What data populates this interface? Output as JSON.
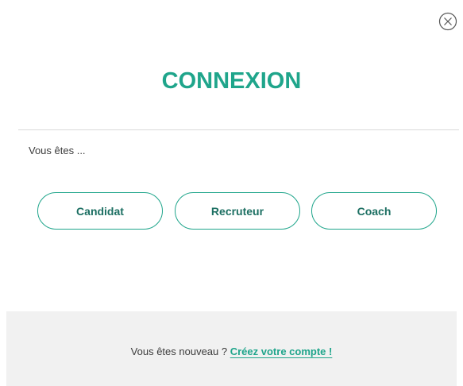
{
  "modal": {
    "close_icon": "close-circle-icon",
    "title": "CONNEXION",
    "prompt": "Vous êtes ...",
    "roles": [
      {
        "label": "Candidat"
      },
      {
        "label": "Recruteur"
      },
      {
        "label": "Coach"
      }
    ],
    "footer": {
      "text": "Vous êtes nouveau ?",
      "link_label": "Créez votre compte !"
    }
  },
  "colors": {
    "accent": "#1fa58b",
    "button_text": "#1c6f62",
    "footer_bg": "#f1f1f1",
    "divider": "#d9d9d9"
  }
}
